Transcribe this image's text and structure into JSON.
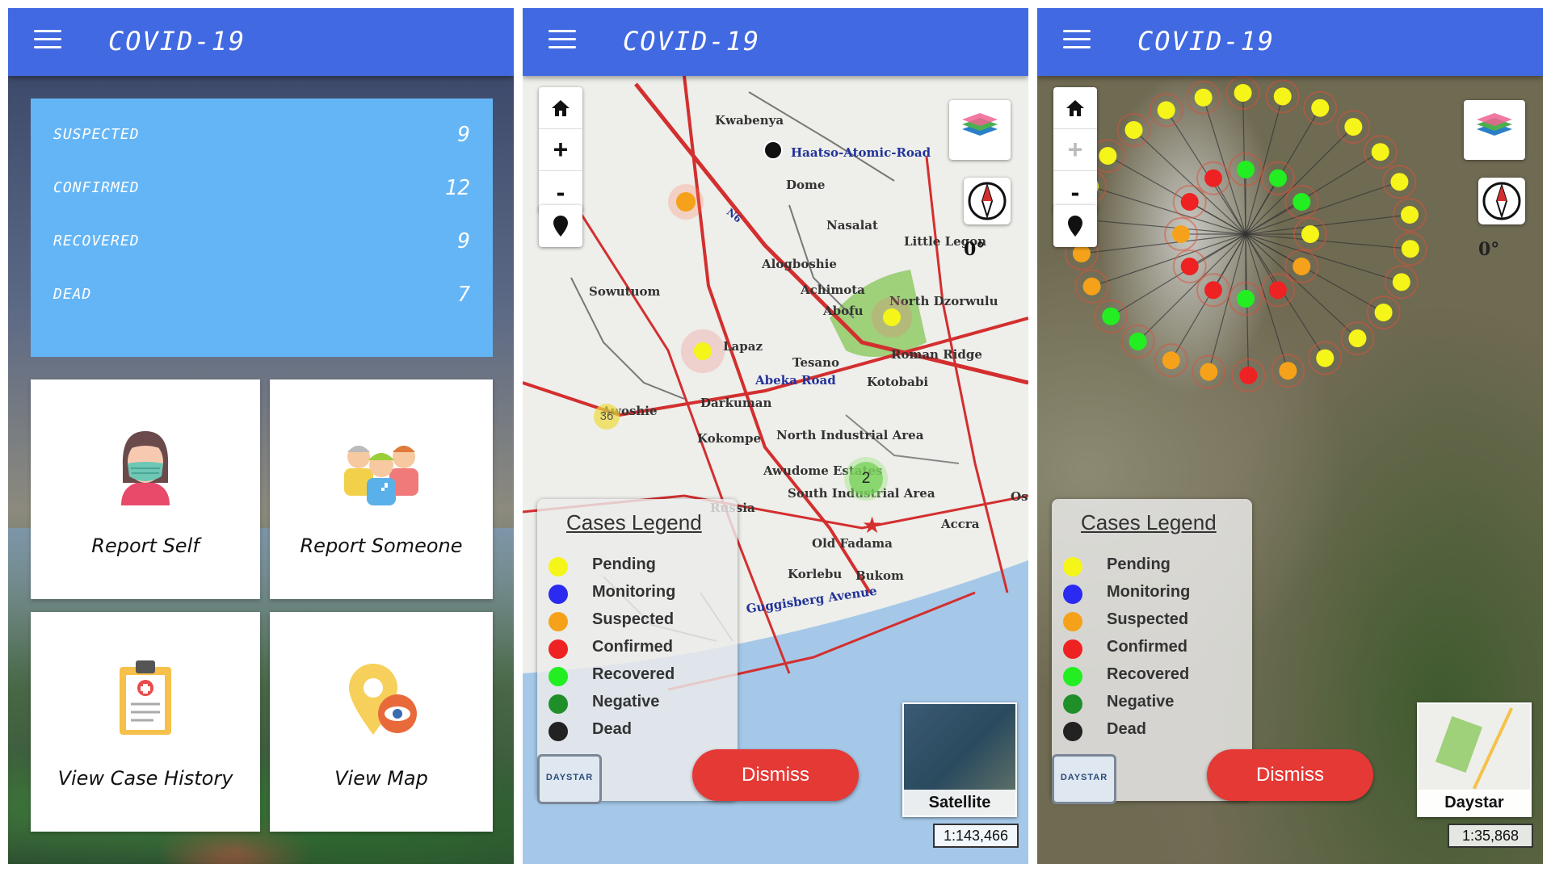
{
  "app": {
    "title": "COVID-19"
  },
  "stats": [
    {
      "label": "SUSPECTED",
      "value": "9"
    },
    {
      "label": "CONFIRMED",
      "value": "12"
    },
    {
      "label": "RECOVERED",
      "value": "9"
    },
    {
      "label": "DEAD",
      "value": "7"
    }
  ],
  "tiles": {
    "report_self": "Report Self",
    "report_someone": "Report Someone",
    "view_case_history": "View Case History",
    "view_map": "View Map"
  },
  "map_street": {
    "places": [
      "Kwabenya",
      "Haatso-Atomic-Road",
      "Dome",
      "Nasalat",
      "Little Legon",
      "Alogboshie",
      "Achimota",
      "Abofu",
      "Sowutuom",
      "North Dzorwulu",
      "Roman Ridge",
      "Lapaz",
      "Tesano",
      "Abeka Road",
      "Kotobabi",
      "Darkuman",
      "North Industrial Area",
      "Kokompe",
      "Awudome Estates",
      "South Industrial Area",
      "Accra",
      "Old Fadama",
      "Korlebu",
      "Bukom",
      "Guggisberg Avenue",
      "Russia",
      "Osu",
      "Awoshie",
      "N6"
    ],
    "cluster_labels": [
      "36",
      "2"
    ],
    "degree": "0°",
    "basemap_label": "Satellite",
    "scale": "1:143,466"
  },
  "map_sat": {
    "degree": "0°",
    "basemap_label": "Daystar",
    "scale": "1:35,868"
  },
  "legend": {
    "title": "Cases Legend",
    "items": [
      {
        "label": "Pending",
        "color": "#f5f51a"
      },
      {
        "label": "Monitoring",
        "color": "#2a2af0"
      },
      {
        "label": "Suspected",
        "color": "#f5a21a"
      },
      {
        "label": "Confirmed",
        "color": "#ee2222"
      },
      {
        "label": "Recovered",
        "color": "#22ee22"
      },
      {
        "label": "Negative",
        "color": "#1f8f2a"
      },
      {
        "label": "Dead",
        "color": "#222222"
      }
    ]
  },
  "controls": {
    "zoom_in": "+",
    "zoom_out": "-"
  },
  "dismiss_label": "Dismiss",
  "logo_text": "DAYSTAR",
  "colors": {
    "appbar": "#4169e1",
    "stats_card": "#64b5f6",
    "dismiss": "#e53935"
  }
}
